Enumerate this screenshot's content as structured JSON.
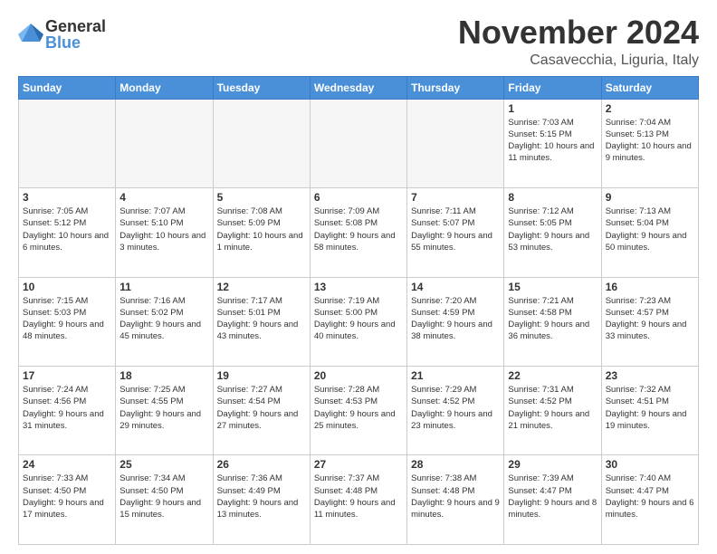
{
  "logo": {
    "general": "General",
    "blue": "Blue"
  },
  "title": "November 2024",
  "location": "Casavecchia, Liguria, Italy",
  "weekdays": [
    "Sunday",
    "Monday",
    "Tuesday",
    "Wednesday",
    "Thursday",
    "Friday",
    "Saturday"
  ],
  "weeks": [
    [
      {
        "day": "",
        "info": ""
      },
      {
        "day": "",
        "info": ""
      },
      {
        "day": "",
        "info": ""
      },
      {
        "day": "",
        "info": ""
      },
      {
        "day": "",
        "info": ""
      },
      {
        "day": "1",
        "info": "Sunrise: 7:03 AM\nSunset: 5:15 PM\nDaylight: 10 hours and 11 minutes."
      },
      {
        "day": "2",
        "info": "Sunrise: 7:04 AM\nSunset: 5:13 PM\nDaylight: 10 hours and 9 minutes."
      }
    ],
    [
      {
        "day": "3",
        "info": "Sunrise: 7:05 AM\nSunset: 5:12 PM\nDaylight: 10 hours and 6 minutes."
      },
      {
        "day": "4",
        "info": "Sunrise: 7:07 AM\nSunset: 5:10 PM\nDaylight: 10 hours and 3 minutes."
      },
      {
        "day": "5",
        "info": "Sunrise: 7:08 AM\nSunset: 5:09 PM\nDaylight: 10 hours and 1 minute."
      },
      {
        "day": "6",
        "info": "Sunrise: 7:09 AM\nSunset: 5:08 PM\nDaylight: 9 hours and 58 minutes."
      },
      {
        "day": "7",
        "info": "Sunrise: 7:11 AM\nSunset: 5:07 PM\nDaylight: 9 hours and 55 minutes."
      },
      {
        "day": "8",
        "info": "Sunrise: 7:12 AM\nSunset: 5:05 PM\nDaylight: 9 hours and 53 minutes."
      },
      {
        "day": "9",
        "info": "Sunrise: 7:13 AM\nSunset: 5:04 PM\nDaylight: 9 hours and 50 minutes."
      }
    ],
    [
      {
        "day": "10",
        "info": "Sunrise: 7:15 AM\nSunset: 5:03 PM\nDaylight: 9 hours and 48 minutes."
      },
      {
        "day": "11",
        "info": "Sunrise: 7:16 AM\nSunset: 5:02 PM\nDaylight: 9 hours and 45 minutes."
      },
      {
        "day": "12",
        "info": "Sunrise: 7:17 AM\nSunset: 5:01 PM\nDaylight: 9 hours and 43 minutes."
      },
      {
        "day": "13",
        "info": "Sunrise: 7:19 AM\nSunset: 5:00 PM\nDaylight: 9 hours and 40 minutes."
      },
      {
        "day": "14",
        "info": "Sunrise: 7:20 AM\nSunset: 4:59 PM\nDaylight: 9 hours and 38 minutes."
      },
      {
        "day": "15",
        "info": "Sunrise: 7:21 AM\nSunset: 4:58 PM\nDaylight: 9 hours and 36 minutes."
      },
      {
        "day": "16",
        "info": "Sunrise: 7:23 AM\nSunset: 4:57 PM\nDaylight: 9 hours and 33 minutes."
      }
    ],
    [
      {
        "day": "17",
        "info": "Sunrise: 7:24 AM\nSunset: 4:56 PM\nDaylight: 9 hours and 31 minutes."
      },
      {
        "day": "18",
        "info": "Sunrise: 7:25 AM\nSunset: 4:55 PM\nDaylight: 9 hours and 29 minutes."
      },
      {
        "day": "19",
        "info": "Sunrise: 7:27 AM\nSunset: 4:54 PM\nDaylight: 9 hours and 27 minutes."
      },
      {
        "day": "20",
        "info": "Sunrise: 7:28 AM\nSunset: 4:53 PM\nDaylight: 9 hours and 25 minutes."
      },
      {
        "day": "21",
        "info": "Sunrise: 7:29 AM\nSunset: 4:52 PM\nDaylight: 9 hours and 23 minutes."
      },
      {
        "day": "22",
        "info": "Sunrise: 7:31 AM\nSunset: 4:52 PM\nDaylight: 9 hours and 21 minutes."
      },
      {
        "day": "23",
        "info": "Sunrise: 7:32 AM\nSunset: 4:51 PM\nDaylight: 9 hours and 19 minutes."
      }
    ],
    [
      {
        "day": "24",
        "info": "Sunrise: 7:33 AM\nSunset: 4:50 PM\nDaylight: 9 hours and 17 minutes."
      },
      {
        "day": "25",
        "info": "Sunrise: 7:34 AM\nSunset: 4:50 PM\nDaylight: 9 hours and 15 minutes."
      },
      {
        "day": "26",
        "info": "Sunrise: 7:36 AM\nSunset: 4:49 PM\nDaylight: 9 hours and 13 minutes."
      },
      {
        "day": "27",
        "info": "Sunrise: 7:37 AM\nSunset: 4:48 PM\nDaylight: 9 hours and 11 minutes."
      },
      {
        "day": "28",
        "info": "Sunrise: 7:38 AM\nSunset: 4:48 PM\nDaylight: 9 hours and 9 minutes."
      },
      {
        "day": "29",
        "info": "Sunrise: 7:39 AM\nSunset: 4:47 PM\nDaylight: 9 hours and 8 minutes."
      },
      {
        "day": "30",
        "info": "Sunrise: 7:40 AM\nSunset: 4:47 PM\nDaylight: 9 hours and 6 minutes."
      }
    ]
  ]
}
